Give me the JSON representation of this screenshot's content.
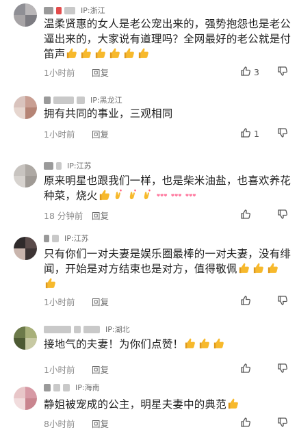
{
  "comments": [
    {
      "ip": "IP:浙江",
      "text": "温柔贤惠的女人是老公宠出来的，强势抱怨也是老公逼出来的，大家说有道理吗？全网最好的老公就是付笛声",
      "emojis": [
        "thumbs-up",
        "thumbs-up",
        "thumbs-up",
        "thumbs-up",
        "thumbs-up",
        "thumbs-up"
      ],
      "time": "1小时前",
      "reply_label": "回复",
      "likes": "3",
      "avatar_colors": [
        "#8f8f95",
        "#b9b6b8",
        "#a7a4a6",
        "#7d7c82"
      ]
    },
    {
      "ip": "IP:黑龙江",
      "text": "拥有共同的事业，三观相同",
      "emojis": [],
      "time": "1小时前",
      "reply_label": "回复",
      "likes": "1",
      "avatar_colors": [
        "#d9c3bd",
        "#c99f93",
        "#e6d6cf",
        "#b58475"
      ]
    },
    {
      "ip": "IP:江苏",
      "text": "原来明星也跟我们一样，也是柴米油盐，也喜欢养花种菜，烧火",
      "emojis": [
        "thumbs-up",
        "finger-heart",
        "finger-heart",
        "finger-heart",
        "hearts-triple",
        "hearts-triple",
        "hearts-triple"
      ],
      "time": "18 分钟前",
      "reply_label": "回复",
      "likes": "",
      "avatar_colors": [
        "#c8c4c0",
        "#aea9a4",
        "#d7d3cf",
        "#9f9a95"
      ]
    },
    {
      "ip": "IP:江苏",
      "text": "只有你们一对夫妻是娱乐圈最棒的一对夫妻，没有绯闻，开始是对方结束也是对方，值得敬佩",
      "emojis": [
        "thumbs-up",
        "thumbs-up",
        "thumbs-up",
        "thumbs-up"
      ],
      "time": "1小时前",
      "reply_label": "回复",
      "likes": "",
      "avatar_colors": [
        "#2f2a2b",
        "#5a4b4a",
        "#c9b5ad",
        "#3d3434"
      ]
    },
    {
      "ip": "IP:湖北",
      "text": "接地气的夫妻！为你们点赞！",
      "emojis": [
        "thumbs-up",
        "thumbs-up",
        "thumbs-up"
      ],
      "time": "1小时前",
      "reply_label": "回复",
      "likes": "",
      "avatar_colors": [
        "#6c7a4a",
        "#a8b07a",
        "#4d5a33",
        "#c7c9a3"
      ]
    },
    {
      "ip": "IP:海南",
      "text": "静姐被宠成的公主，明星夫妻中的典范",
      "emojis": [
        "thumbs-up"
      ],
      "time": "8小时前",
      "reply_label": "回复",
      "likes": "",
      "avatar_colors": [
        "#e8c6c8",
        "#d79aa5",
        "#f1dcdd",
        "#c9858f"
      ]
    }
  ],
  "icons": {
    "like": "thumbs-up-outline-icon",
    "dislike": "thumbs-down-outline-icon",
    "emoji_thumbs_up": "thumbs-up-emoji",
    "emoji_finger_heart": "finger-heart-emoji",
    "emoji_hearts": "triple-hearts-emoji"
  },
  "colors": {
    "text": "#1f1f1f",
    "meta": "#8a8a8a",
    "emoji_yellow": "#f7b92c",
    "emoji_pink": "#ff7aa0"
  }
}
